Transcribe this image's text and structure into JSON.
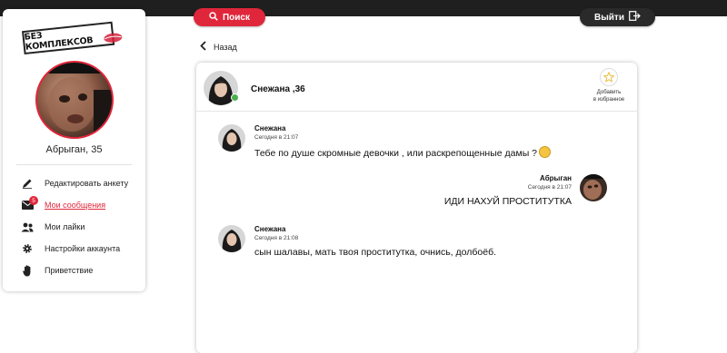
{
  "header": {
    "search_label": "Поиск",
    "logout_label": "Выйти"
  },
  "sidebar": {
    "logo_text": "БЕЗ КОМПЛЕКСОВ",
    "profile_name": "Абрыган, 35",
    "menu": [
      {
        "label": "Редактировать анкету",
        "icon": "pencil-icon"
      },
      {
        "label": "Мои сообщения",
        "icon": "envelope-icon",
        "badge": "5",
        "active": true
      },
      {
        "label": "Мои лайки",
        "icon": "people-icon"
      },
      {
        "label": "Настройки аккаунта",
        "icon": "gear-icon"
      },
      {
        "label": "Приветствие",
        "icon": "hand-icon"
      }
    ]
  },
  "back_label": "Назад",
  "chat": {
    "partner_title": "Снежана ,36",
    "favorite_label_1": "Добавить",
    "favorite_label_2": "в избранное",
    "messages": [
      {
        "author": "Снежана",
        "time": "Сегодня в 21:07",
        "text": "Тебе по душе скромные девочки , или раскрепощенные дамы ?",
        "side": "left"
      },
      {
        "author": "Абрыган",
        "time": "Сегодня в 21:07",
        "text": "ИДИ НАХУЙ ПРОСТИТУТКА",
        "side": "right"
      },
      {
        "author": "Снежана",
        "time": "Сегодня в 21:08",
        "text": "сын шалавы, мать твоя проститутка, очнись, долбоёб.",
        "side": "left"
      }
    ]
  },
  "colors": {
    "accent": "#e0263a",
    "dark": "#1f1f1f",
    "online": "#4caf50"
  }
}
